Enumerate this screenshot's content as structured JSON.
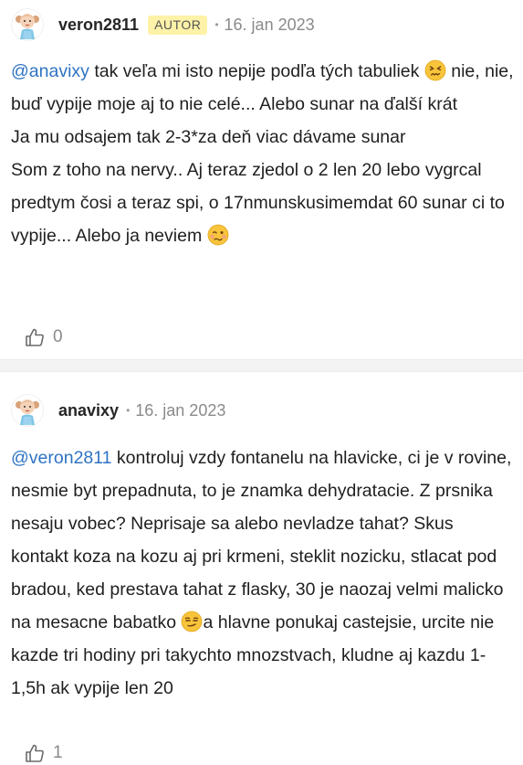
{
  "comments": [
    {
      "username": "veron2811",
      "badge": "AUTOR",
      "separator": "•",
      "date": "16. jan 2023",
      "mention": "@anavixy",
      "text_1": " tak veľa mi isto nepije podľa tých tabuliek ",
      "emoji_1": "confounded-face",
      "text_2": " nie, nie, buď vypije moje aj to nie celé... Alebo sunar na ďalší krát",
      "line_3": "Ja mu odsajem tak 2-3*za deň viac dávame sunar",
      "line_4": "Som z toho na nervy.. Aj teraz zjedol o 2 len 20 lebo vygrcal predtym čosi a teraz spi, o 17nmunskusimemdat 60 sunar ci to vypije... Alebo ja neviem ",
      "emoji_2": "woozy-face",
      "likes": "0"
    },
    {
      "username": "anavixy",
      "separator": "•",
      "date": "16. jan 2023",
      "mention": "@veron2811",
      "text_1": " kontroluj vzdy fontanelu na hlavicke, ci je v rovine, nesmie byt prepadnuta, to je znamka dehydratacie. Z prsnika nesaju vobec? Neprisaje sa alebo nevladze tahat? Skus kontakt koza na kozu aj pri krmeni, steklit nozicku, stlacat pod bradou, ked prestava tahat z flasky, 30 je naozaj velmi malicko na mesacne babatko ",
      "emoji_1": "smirking-face",
      "text_2": "a hlavne ponukaj castejsie, urcite nie kazde tri hodiny pri takychto mnozstvach, kludne aj kazdu 1-1,5h ak vypije len 20",
      "likes": "1"
    }
  ],
  "colors": {
    "mention": "#2f73c3",
    "badge_bg": "#fdf2a8",
    "divider": "#f3f3f3",
    "meta": "#8a8a8a"
  }
}
